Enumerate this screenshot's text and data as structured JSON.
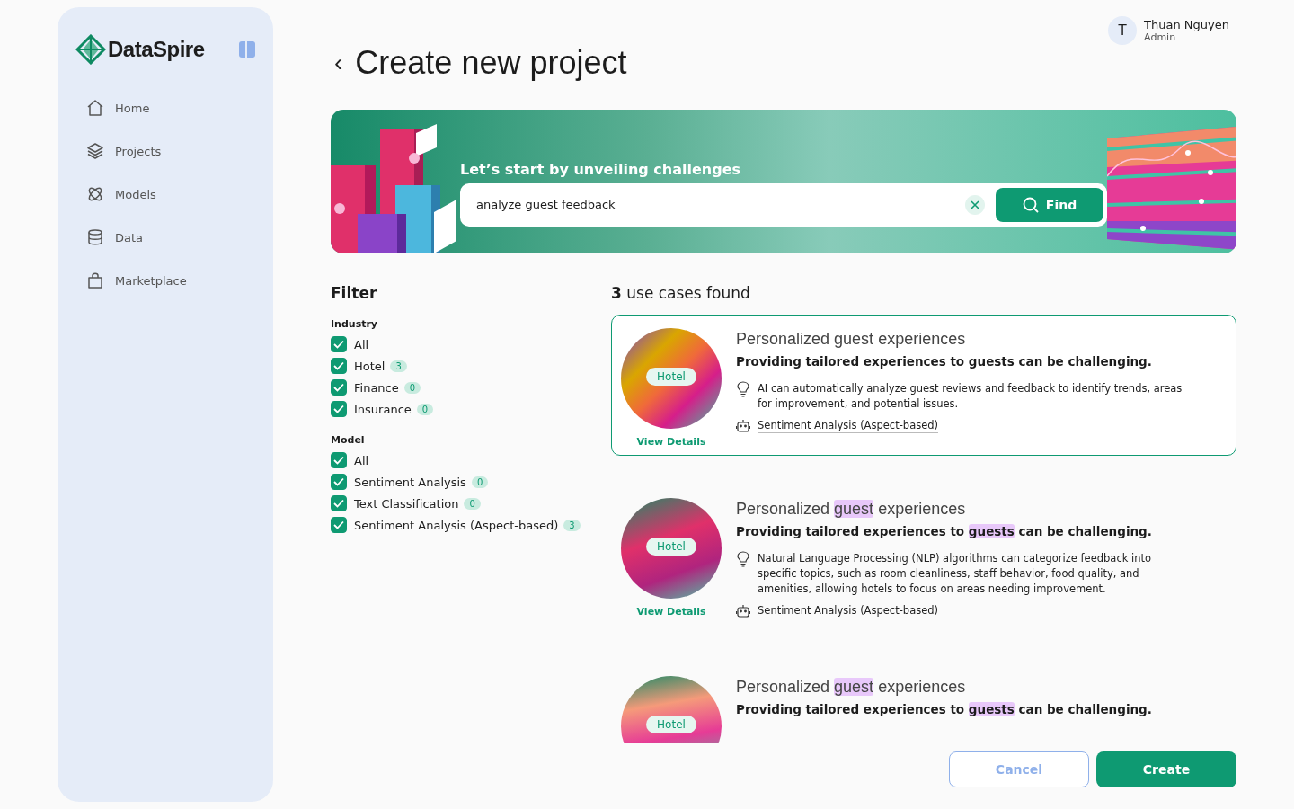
{
  "sidebar": {
    "logo": "DataSpire",
    "items": [
      {
        "label": "Home",
        "selected": false
      },
      {
        "label": "Projects",
        "selected": false
      },
      {
        "label": "Models",
        "selected": false
      },
      {
        "label": "Data",
        "selected": false
      },
      {
        "label": "Marketplace",
        "selected": false
      }
    ]
  },
  "user": {
    "initial": "T",
    "name": "Thuan Nguyen",
    "role": "Admin"
  },
  "page": {
    "back": "‹",
    "title": "Create new project"
  },
  "banner": {
    "heading": "Let’s start by unveiling challenges",
    "search_value": "analyze guest feedback",
    "find_button": "Find"
  },
  "filter": {
    "title": "Filter",
    "groups": [
      {
        "label": "Industry",
        "options": [
          {
            "label": "All",
            "checked": true
          },
          {
            "label": "Hotel",
            "checked": true,
            "count": "3"
          },
          {
            "label": "Finance",
            "checked": true,
            "count": "0"
          },
          {
            "label": "Insurance",
            "checked": true,
            "count": "0"
          }
        ]
      },
      {
        "label": "Model",
        "options": [
          {
            "label": "All",
            "checked": true
          },
          {
            "label": "Sentiment Analysis",
            "checked": true,
            "count": "0"
          },
          {
            "label": "Text Classification",
            "checked": true,
            "count": "0"
          },
          {
            "label": "Sentiment Analysis (Aspect-based)",
            "checked": true,
            "count": "3"
          }
        ]
      }
    ]
  },
  "results": {
    "count": "3",
    "label": "use cases found",
    "cards": [
      {
        "selected": true,
        "tag": "Hotel",
        "link": "View Details",
        "title": [
          {
            "text": "Personalized ",
            "highlight": false
          },
          {
            "text": "guest",
            "highlight": false
          },
          {
            "text": " experiences",
            "highlight": false
          }
        ],
        "problem": [
          {
            "text": "Providing tailored experiences to ",
            "highlight": false
          },
          {
            "text": "guests",
            "highlight": false
          },
          {
            "text": " can be challenging.",
            "highlight": false
          }
        ],
        "insight": "AI can automatically analyze guest reviews and feedback to identify trends, areas for improvement, and potential issues.",
        "model": "Sentiment Analysis (Aspect-based)"
      },
      {
        "selected": false,
        "tag": "Hotel",
        "link": "View Details",
        "title": [
          {
            "text": "Personalized ",
            "highlight": false
          },
          {
            "text": "guest",
            "highlight": true
          },
          {
            "text": " experiences",
            "highlight": false
          }
        ],
        "problem": [
          {
            "text": "Providing tailored experiences to ",
            "highlight": false
          },
          {
            "text": "guests",
            "highlight": true
          },
          {
            "text": " can be challenging.",
            "highlight": false
          }
        ],
        "insight": "Natural Language Processing (NLP) algorithms can categorize feedback into specific topics, such as room cleanliness, staff behavior, food quality, and amenities, allowing hotels to focus on areas needing improvement.",
        "model": "Sentiment Analysis (Aspect-based)"
      },
      {
        "selected": false,
        "tag": "Hotel",
        "title": [
          {
            "text": "Personalized ",
            "highlight": false
          },
          {
            "text": "guest",
            "highlight": true
          },
          {
            "text": " experiences",
            "highlight": false
          }
        ],
        "problem": [
          {
            "text": "Providing tailored experiences to ",
            "highlight": false
          },
          {
            "text": "guests",
            "highlight": true
          },
          {
            "text": " can be challenging.",
            "highlight": false
          }
        ]
      }
    ]
  },
  "actions": {
    "cancel": "Cancel",
    "create": "Create"
  }
}
